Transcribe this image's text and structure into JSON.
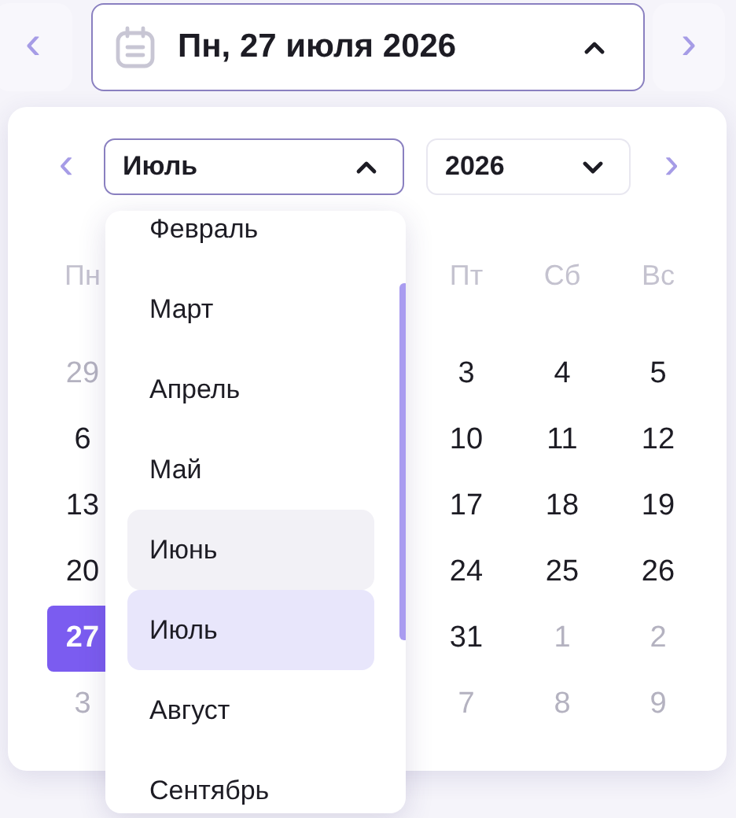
{
  "date_picker": {
    "prev_symbol": "‹",
    "label": "Пн, 27 июля 2026",
    "expanded": true,
    "next_symbol": "›"
  },
  "calendar": {
    "prev_symbol": "‹",
    "next_symbol": "›",
    "month_select": {
      "value": "Июль",
      "expanded": true
    },
    "year_select": {
      "value": "2026",
      "expanded": false
    },
    "left_columns": [
      {
        "weekday": "Пн",
        "days": [
          {
            "text": "29",
            "outside": true,
            "selected": false
          },
          {
            "text": "6",
            "outside": false,
            "selected": false
          },
          {
            "text": "13",
            "outside": false,
            "selected": false
          },
          {
            "text": "20",
            "outside": false,
            "selected": false
          },
          {
            "text": "27",
            "outside": false,
            "selected": true
          },
          {
            "text": "3",
            "outside": true,
            "selected": false
          }
        ]
      }
    ],
    "right_columns": [
      {
        "weekday": "Пт",
        "days": [
          {
            "text": "3",
            "outside": false,
            "selected": false
          },
          {
            "text": "10",
            "outside": false,
            "selected": false
          },
          {
            "text": "17",
            "outside": false,
            "selected": false
          },
          {
            "text": "24",
            "outside": false,
            "selected": false
          },
          {
            "text": "31",
            "outside": false,
            "selected": false
          },
          {
            "text": "7",
            "outside": true,
            "selected": false
          }
        ]
      },
      {
        "weekday": "Сб",
        "days": [
          {
            "text": "4",
            "outside": false,
            "selected": false
          },
          {
            "text": "11",
            "outside": false,
            "selected": false
          },
          {
            "text": "18",
            "outside": false,
            "selected": false
          },
          {
            "text": "25",
            "outside": false,
            "selected": false
          },
          {
            "text": "1",
            "outside": true,
            "selected": false
          },
          {
            "text": "8",
            "outside": true,
            "selected": false
          }
        ]
      },
      {
        "weekday": "Вс",
        "days": [
          {
            "text": "5",
            "outside": false,
            "selected": false
          },
          {
            "text": "12",
            "outside": false,
            "selected": false
          },
          {
            "text": "19",
            "outside": false,
            "selected": false
          },
          {
            "text": "26",
            "outside": false,
            "selected": false
          },
          {
            "text": "2",
            "outside": true,
            "selected": false
          },
          {
            "text": "9",
            "outside": true,
            "selected": false
          }
        ]
      }
    ],
    "month_options": [
      {
        "label": "Февраль",
        "selected": false,
        "highlighted": false
      },
      {
        "label": "Март",
        "selected": false,
        "highlighted": false
      },
      {
        "label": "Апрель",
        "selected": false,
        "highlighted": false
      },
      {
        "label": "Май",
        "selected": false,
        "highlighted": false
      },
      {
        "label": "Июнь",
        "selected": false,
        "highlighted": true
      },
      {
        "label": "Июль",
        "selected": true,
        "highlighted": false
      },
      {
        "label": "Август",
        "selected": false,
        "highlighted": false
      },
      {
        "label": "Сентябрь",
        "selected": false,
        "highlighted": false
      }
    ]
  }
}
